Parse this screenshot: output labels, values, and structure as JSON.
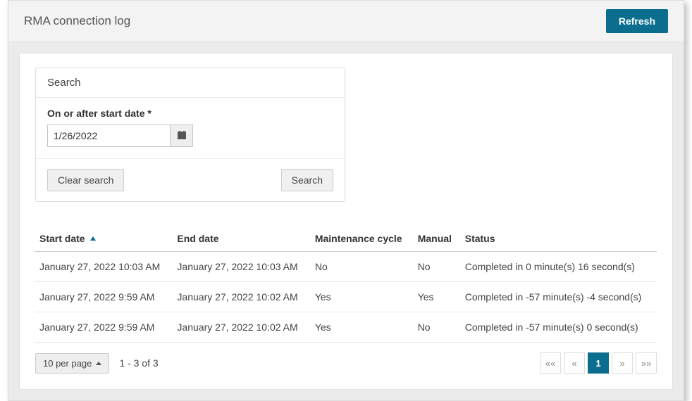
{
  "header": {
    "title": "RMA connection log",
    "refresh_label": "Refresh"
  },
  "search": {
    "card_title": "Search",
    "date_label": "On or after start date *",
    "date_value": "1/26/2022",
    "clear_label": "Clear search",
    "search_label": "Search"
  },
  "table": {
    "headers": {
      "start": "Start date",
      "end": "End date",
      "maintenance": "Maintenance cycle",
      "manual": "Manual",
      "status": "Status"
    },
    "rows": [
      {
        "start": "January 27, 2022 10:03 AM",
        "end": "January 27, 2022 10:03 AM",
        "maintenance": "No",
        "manual": "No",
        "status": "Completed in 0 minute(s) 16 second(s)"
      },
      {
        "start": "January 27, 2022 9:59 AM",
        "end": "January 27, 2022 10:02 AM",
        "maintenance": "Yes",
        "manual": "Yes",
        "status": "Completed in -57 minute(s) -4 second(s)"
      },
      {
        "start": "January 27, 2022 9:59 AM",
        "end": "January 27, 2022 10:02 AM",
        "maintenance": "Yes",
        "manual": "No",
        "status": "Completed in -57 minute(s) 0 second(s)"
      }
    ]
  },
  "pagination": {
    "per_page_label": "10 per page",
    "result_text": "1 - 3 of 3",
    "first": "««",
    "prev": "«",
    "page1": "1",
    "next": "»",
    "last": "»»"
  }
}
